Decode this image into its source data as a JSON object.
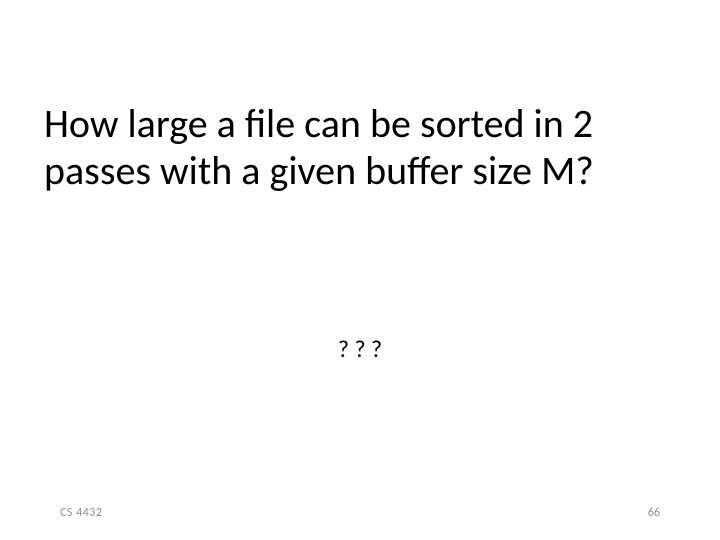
{
  "title": "How large a file can be sorted in 2 passes with a given buffer size M?",
  "body": "? ? ?",
  "footer": {
    "left": "CS 4432",
    "right": "66"
  }
}
